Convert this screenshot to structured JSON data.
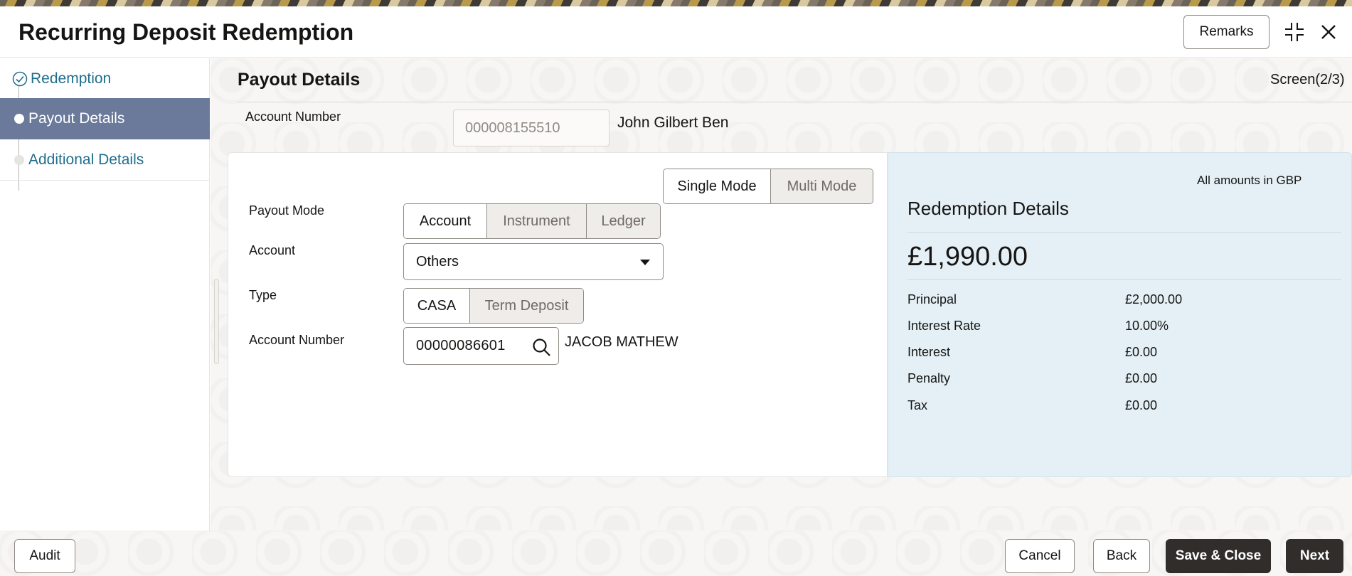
{
  "header": {
    "title": "Recurring Deposit Redemption",
    "remarks_label": "Remarks"
  },
  "sidebar": {
    "steps": [
      {
        "label": "Redemption",
        "state": "completed"
      },
      {
        "label": "Payout Details",
        "state": "active"
      },
      {
        "label": "Additional Details",
        "state": "pending"
      }
    ]
  },
  "section": {
    "title": "Payout Details",
    "screen_indicator": "Screen(2/3)"
  },
  "account": {
    "label": "Account Number",
    "value": "000008155510",
    "holder_name": "John Gilbert Ben"
  },
  "payout": {
    "mode_toggle": [
      "Single Mode",
      "Multi Mode"
    ],
    "mode_toggle_selected": "Single Mode",
    "payout_mode_label": "Payout Mode",
    "payout_mode_options": [
      "Account",
      "Instrument",
      "Ledger"
    ],
    "payout_mode_selected": "Account",
    "account_label": "Account",
    "account_value": "Others",
    "type_label": "Type",
    "type_options": [
      "CASA",
      "Term Deposit"
    ],
    "type_selected": "CASA",
    "account_number_label": "Account Number",
    "account_number_value": "00000086601",
    "account_number_name": "JACOB MATHEW"
  },
  "redemption_details": {
    "currency_note": "All amounts in GBP",
    "title": "Redemption Details",
    "total": "£1,990.00",
    "rows": [
      {
        "label": "Principal",
        "value": "£2,000.00"
      },
      {
        "label": "Interest Rate",
        "value": "10.00%"
      },
      {
        "label": "Interest",
        "value": "£0.00"
      },
      {
        "label": "Penalty",
        "value": "£0.00"
      },
      {
        "label": "Tax",
        "value": "£0.00"
      }
    ]
  },
  "footer": {
    "audit": "Audit",
    "cancel": "Cancel",
    "back": "Back",
    "save_close": "Save & Close",
    "next": "Next"
  },
  "colors": {
    "active_step_bg": "#6b7a9a",
    "link_text": "#1e6e8c",
    "summary_bg": "#e4f0f6",
    "primary_button": "#312d2a"
  }
}
